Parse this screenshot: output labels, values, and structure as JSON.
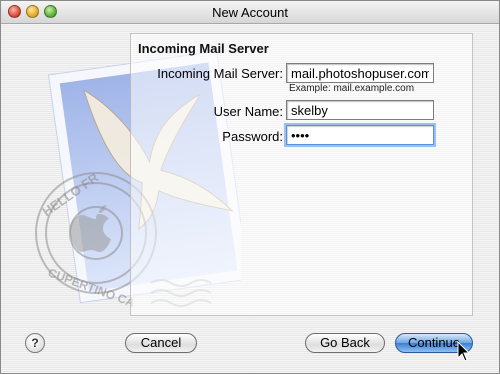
{
  "window": {
    "title": "New Account"
  },
  "section": {
    "title": "Incoming Mail Server"
  },
  "form": {
    "server_label": "Incoming Mail Server:",
    "server_value": "mail.photoshopuser.com",
    "server_example": "Example: mail.example.com",
    "username_label": "User Name:",
    "username_value": "skelby",
    "password_label": "Password:",
    "password_value": "••••"
  },
  "buttons": {
    "help": "?",
    "cancel": "Cancel",
    "go_back": "Go Back",
    "continue": "Continue"
  },
  "stamp": {
    "text_top": "HELLO FR",
    "text_bottom": "CUPERTINO CA"
  },
  "colors": {
    "accent": "#3d7fd3",
    "focus_ring": "#9cc0ef"
  }
}
